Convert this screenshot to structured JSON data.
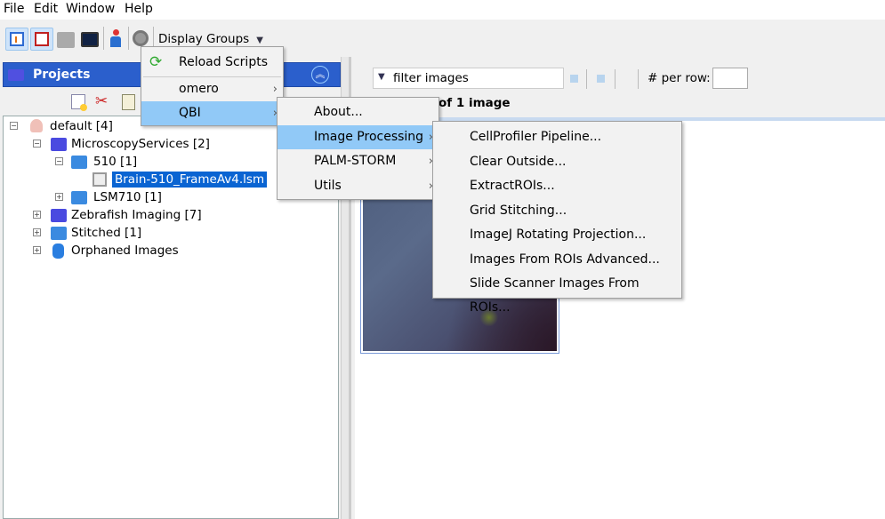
{
  "menubar": {
    "items": [
      "File",
      "Edit",
      "Window",
      "Help"
    ]
  },
  "toolbar": {
    "display_groups": "Display Groups",
    "icons": [
      "tree-view-icon",
      "edit-icon",
      "grid-icon",
      "screen-icon",
      "people-icon",
      "scripts-gear-icon"
    ]
  },
  "projects": {
    "title": "Projects",
    "toolbar_icons": [
      "new-icon",
      "cut-icon",
      "paste-icon"
    ]
  },
  "tree": {
    "items": [
      {
        "label": "default [4]",
        "icon": "user-icon"
      },
      {
        "label": "MicroscopyServices [2]",
        "icon": "project-folder-icon"
      },
      {
        "label": "510 [1]",
        "icon": "dataset-icon"
      },
      {
        "label": "Brain-510_FrameAv4.lsm",
        "icon": "image-icon",
        "selected": true
      },
      {
        "label": "LSM710 [1]",
        "icon": "dataset-icon"
      },
      {
        "label": "Zebrafish Imaging [7]",
        "icon": "project-folder-icon"
      },
      {
        "label": "Stitched [1]",
        "icon": "dataset-icon"
      },
      {
        "label": "Orphaned Images",
        "icon": "database-icon"
      }
    ]
  },
  "viewer": {
    "filter_label": "filter  images",
    "per_row_label": "# per row:",
    "per_row_value": "",
    "count_text": "of 1 image"
  },
  "scripts_menu": {
    "items": [
      {
        "label": "Reload Scripts"
      },
      {
        "label": "omero",
        "submenu": true
      },
      {
        "label": "QBI",
        "submenu": true,
        "highlighted": true
      }
    ]
  },
  "qbi_menu": {
    "items": [
      {
        "label": "About..."
      },
      {
        "label": "Image Processing",
        "submenu": true,
        "highlighted": true
      },
      {
        "label": "PALM-STORM",
        "submenu": true
      },
      {
        "label": "Utils",
        "submenu": true
      }
    ]
  },
  "image_processing_menu": {
    "items": [
      "CellProfiler Pipeline...",
      "Clear Outside...",
      "ExtractROIs...",
      "Grid Stitching...",
      "ImageJ Rotating Projection...",
      "Images From ROIs Advanced...",
      "Slide Scanner Images From ROIs..."
    ]
  },
  "colors": {
    "header_blue": "#2b5fcc",
    "highlight": "#91c9f7",
    "selection": "#0a64d2"
  }
}
